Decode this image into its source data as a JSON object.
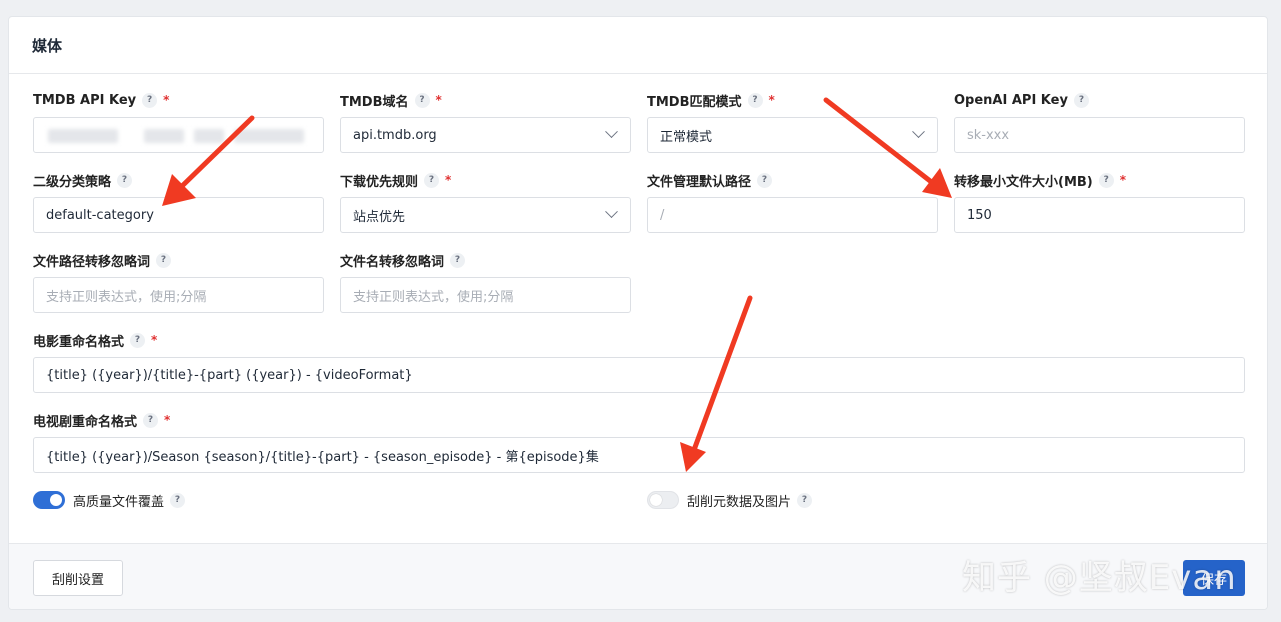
{
  "section": {
    "title": "媒体"
  },
  "fields": {
    "tmdb_api_key": {
      "label": "TMDB API Key",
      "value": ""
    },
    "tmdb_domain": {
      "label": "TMDB域名",
      "value": "api.tmdb.org"
    },
    "tmdb_match_mode": {
      "label": "TMDB匹配模式",
      "value": "正常模式"
    },
    "openai_api_key": {
      "label": "OpenAI API Key",
      "placeholder": "sk-xxx"
    },
    "category_policy": {
      "label": "二级分类策略",
      "value": "default-category"
    },
    "download_priority": {
      "label": "下载优先规则",
      "value": "站点优先"
    },
    "file_default_path": {
      "label": "文件管理默认路径",
      "placeholder": "/"
    },
    "min_transfer_size": {
      "label": "转移最小文件大小(MB)",
      "value": "150"
    },
    "path_ignore_words": {
      "label": "文件路径转移忽略词",
      "placeholder": "支持正则表达式，使用;分隔"
    },
    "filename_ignore_words": {
      "label": "文件名转移忽略词",
      "placeholder": "支持正则表达式，使用;分隔"
    },
    "movie_rename_format": {
      "label": "电影重命名格式",
      "value": "{title} ({year})/{title}-{part} ({year}) - {videoFormat}"
    },
    "tv_rename_format": {
      "label": "电视剧重命名格式",
      "value": "{title} ({year})/Season {season}/{title}-{part} - {season_episode} - 第{episode}集"
    }
  },
  "toggles": {
    "hq_overwrite": {
      "label": "高质量文件覆盖",
      "on": true
    },
    "scrape_metadata": {
      "label": "刮削元数据及图片",
      "on": false
    }
  },
  "help_glyph": "?",
  "required_mark": "*",
  "footer": {
    "scrape_settings_label": "刮削设置",
    "save_label": "保存"
  },
  "watermark": "知乎 @坚叔Evan",
  "colors": {
    "primary": "#2563c9",
    "required": "#e03131",
    "annotation_arrow": "#f03a22"
  }
}
